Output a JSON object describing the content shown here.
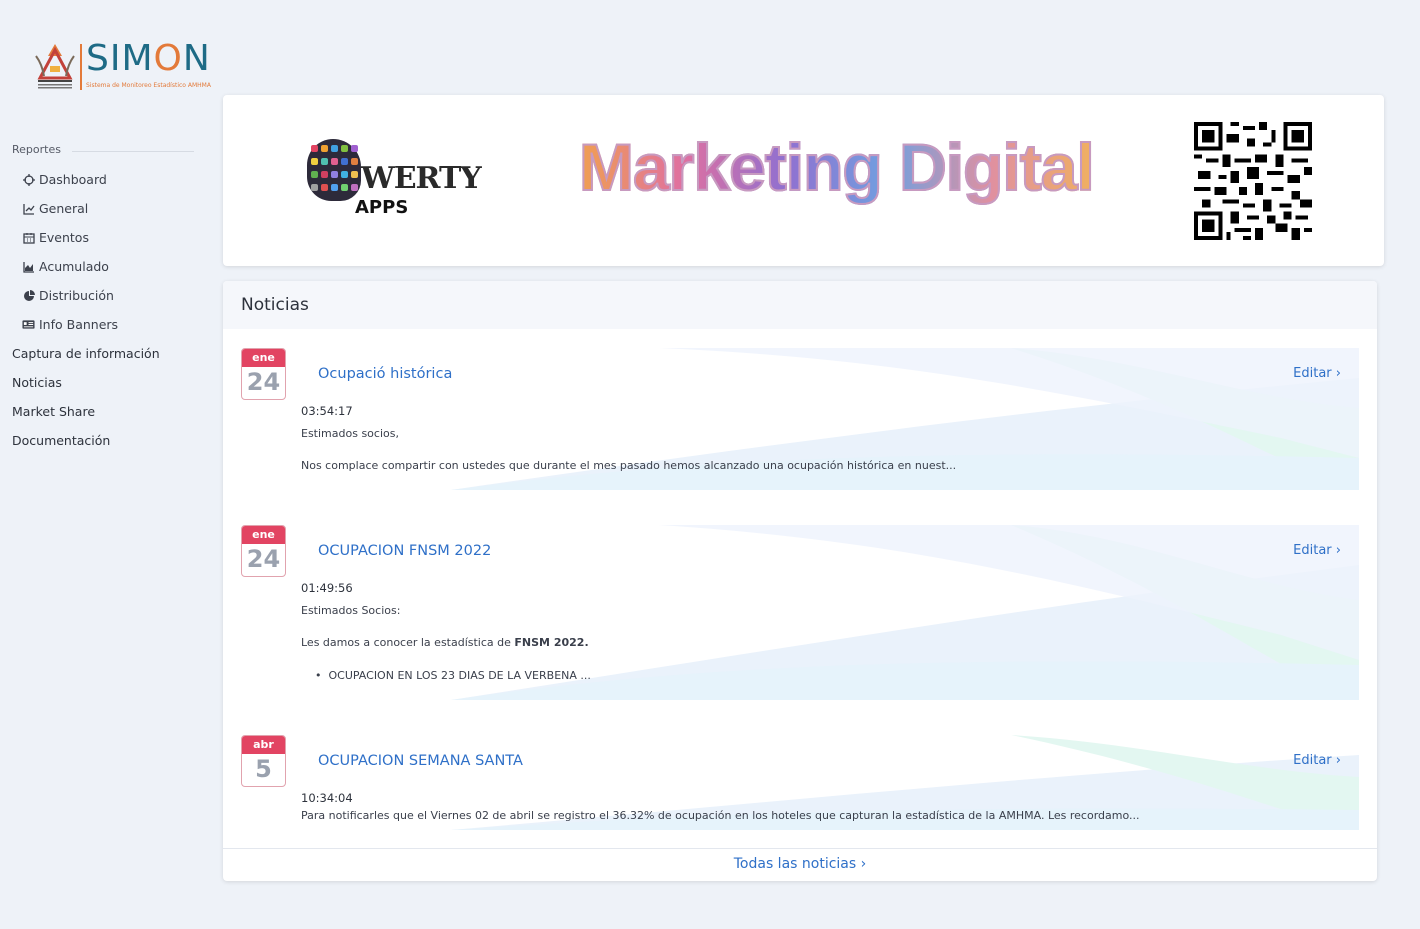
{
  "brand": {
    "name_prefix": "SIM",
    "name_o": "O",
    "name_suffix": "N",
    "subtitle": "Sistema de Monitoreo Estadístico AMHMA",
    "emblem_caption": "ASOCIACIÓN MEXICANA DE HOTELES Y MOTELES DE AGUASCALIENTES"
  },
  "sidebar": {
    "section": "Reportes",
    "sub_items": [
      {
        "label": "Dashboard",
        "icon": "crosshair-icon"
      },
      {
        "label": "General",
        "icon": "line-chart-icon"
      },
      {
        "label": "Eventos",
        "icon": "calendar-icon"
      },
      {
        "label": "Acumulado",
        "icon": "area-chart-icon"
      },
      {
        "label": "Distribución",
        "icon": "pie-chart-icon"
      },
      {
        "label": "Info Banners",
        "icon": "id-card-icon"
      }
    ],
    "top_items": [
      {
        "label": "Captura de información"
      },
      {
        "label": "Noticias"
      },
      {
        "label": "Market Share"
      },
      {
        "label": "Documentación"
      }
    ]
  },
  "banner": {
    "qwerty_word": "WERTY",
    "qwerty_apps": "APPS",
    "headline": "Marketing Digital"
  },
  "news": {
    "title": "Noticias",
    "edit_label": "Editar",
    "footer_link": "Todas las noticias",
    "items": [
      {
        "month": "ene",
        "day": "24",
        "title": "Ocupació histórica",
        "time": "03:54:17",
        "greeting": "Estimados socios,",
        "body": "Nos complace compartir con ustedes que durante el mes pasado hemos alcanzado una ocupación histórica en nuest..."
      },
      {
        "month": "ene",
        "day": "24",
        "title": "OCUPACION FNSM 2022",
        "time": "01:49:56",
        "greeting": "Estimados Socios:",
        "body_prefix": "Les damos a conocer la estadística de ",
        "body_bold": "FNSM 2022.",
        "bullet": "OCUPACION EN LOS 23 DIAS DE LA VERBENA ..."
      },
      {
        "month": "abr",
        "day": "5",
        "title": "OCUPACION SEMANA SANTA",
        "time": "10:34:04",
        "body": "Para notificarles que el Viernes 02 de abril se registro el 36.32% de ocupación en los hoteles que capturan la estadística de la AMHMA. Les recordamo..."
      }
    ]
  }
}
